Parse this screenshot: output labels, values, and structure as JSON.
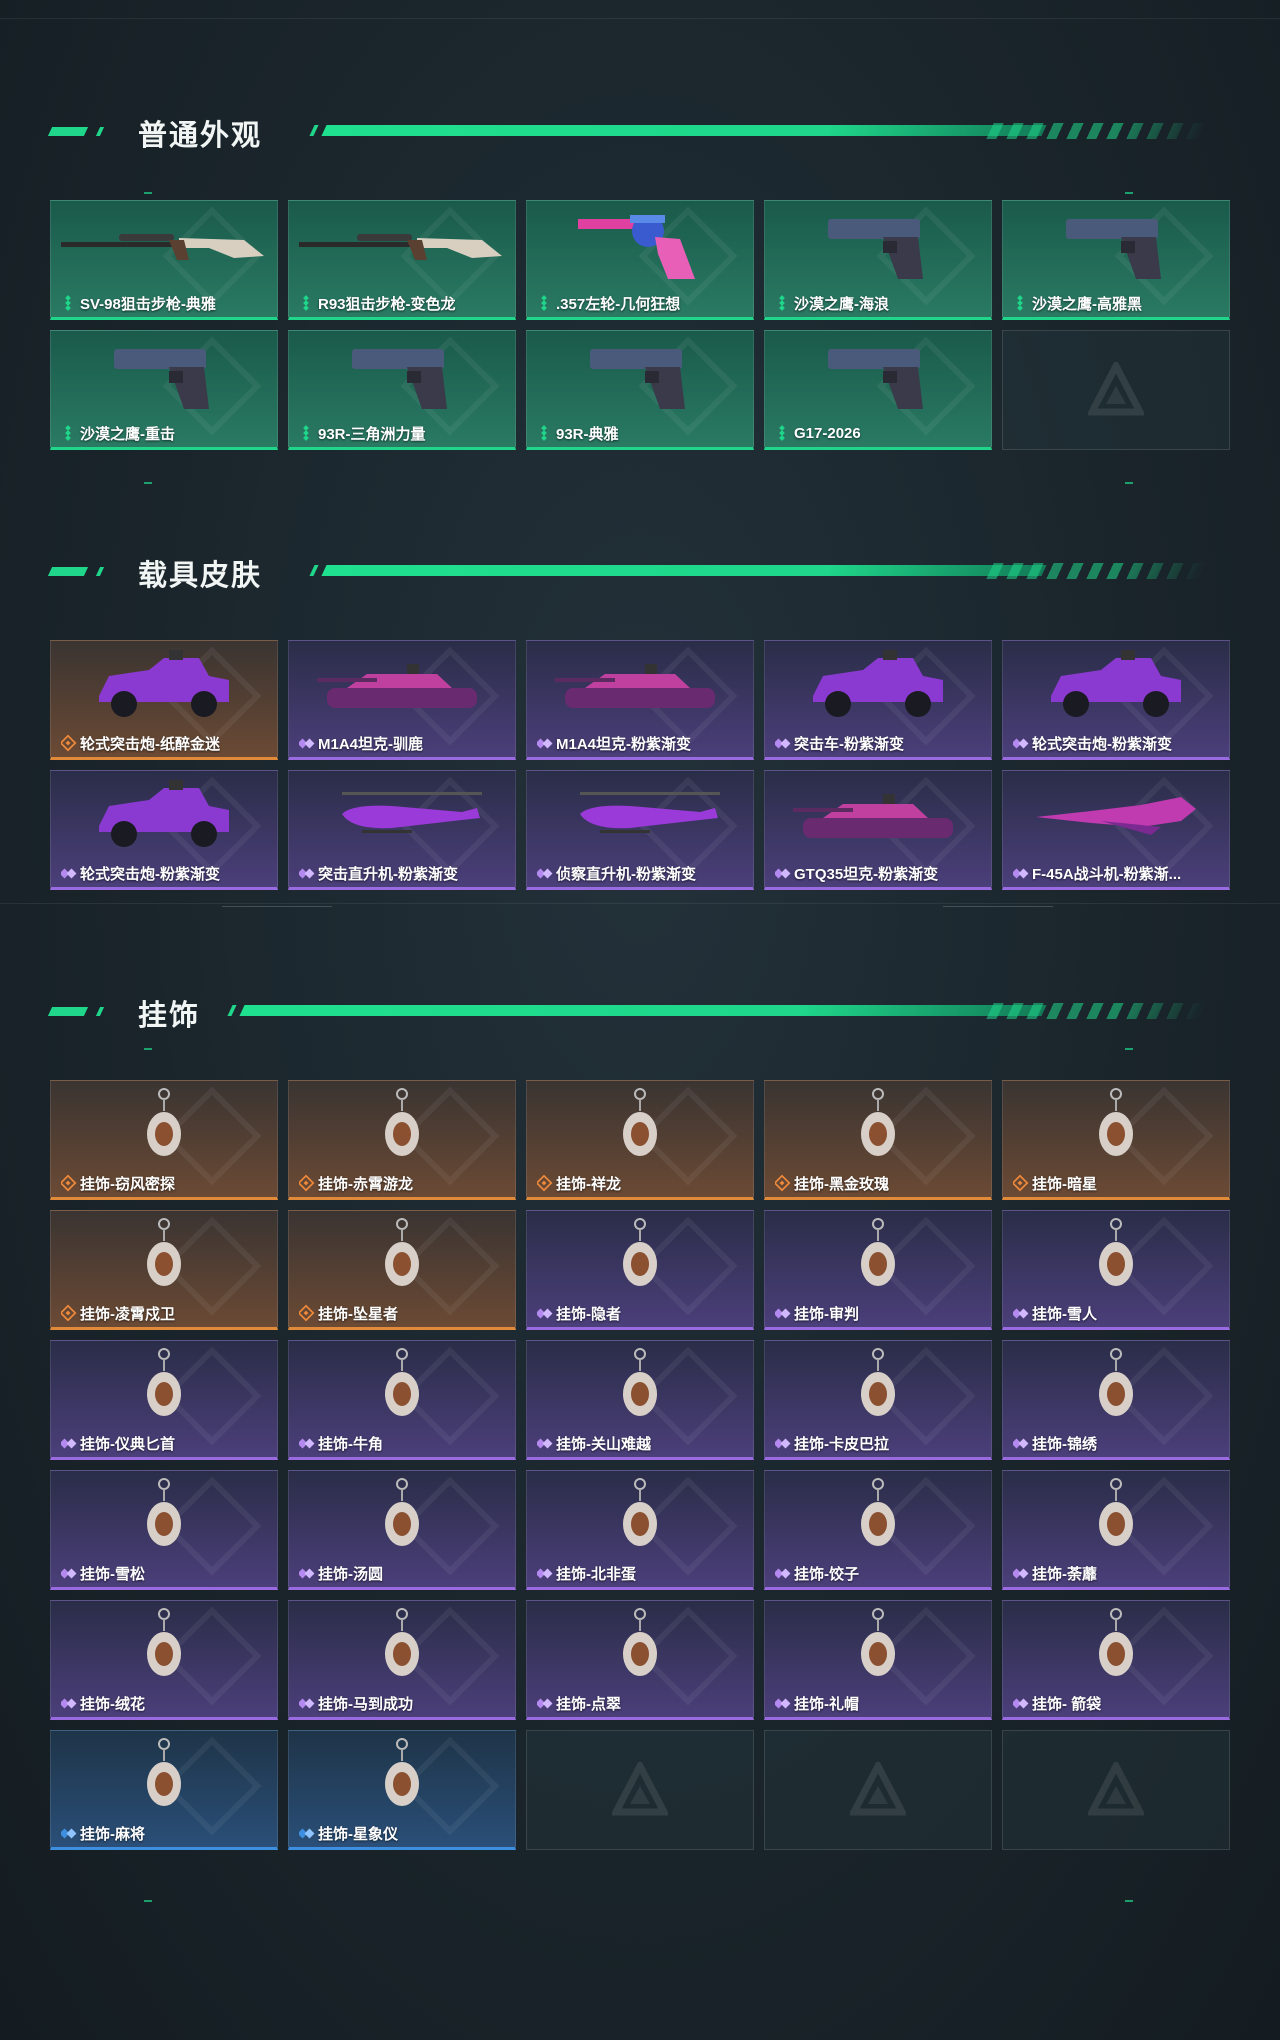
{
  "colors": {
    "accent": "#1fd68a",
    "rarity_green": "#1fd68a",
    "rarity_orange": "#e08a3a",
    "rarity_purple": "#9a6ae0",
    "rarity_blue": "#3f8fe0"
  },
  "sections": [
    {
      "title": "普通外观",
      "items": [
        {
          "label": "SV-98狙击步枪-典雅",
          "rarity": "green",
          "icon": "sniper-rifle-icon"
        },
        {
          "label": "R93狙击步枪-变色龙",
          "rarity": "green",
          "icon": "sniper-rifle-icon"
        },
        {
          "label": ".357左轮-几何狂想",
          "rarity": "green",
          "icon": "revolver-icon"
        },
        {
          "label": "沙漠之鹰-海浪",
          "rarity": "green",
          "icon": "pistol-icon"
        },
        {
          "label": "沙漠之鹰-高雅黑",
          "rarity": "green",
          "icon": "pistol-icon"
        },
        {
          "label": "沙漠之鹰-重击",
          "rarity": "green",
          "icon": "pistol-icon"
        },
        {
          "label": "93R-三角洲力量",
          "rarity": "green",
          "icon": "pistol-icon"
        },
        {
          "label": "93R-典雅",
          "rarity": "green",
          "icon": "pistol-icon"
        },
        {
          "label": "G17-2026",
          "rarity": "green",
          "icon": "pistol-icon"
        },
        {
          "label": "",
          "rarity": "empty",
          "icon": "brand-logo-icon"
        }
      ]
    },
    {
      "title": "载具皮肤",
      "items": [
        {
          "label": "轮式突击炮-纸醉金迷",
          "rarity": "orange",
          "icon": "armored-car-icon"
        },
        {
          "label": "M1A4坦克-驯鹿",
          "rarity": "purple",
          "icon": "tank-icon"
        },
        {
          "label": "M1A4坦克-粉紫渐变",
          "rarity": "purple",
          "icon": "tank-icon"
        },
        {
          "label": "突击车-粉紫渐变",
          "rarity": "purple",
          "icon": "armored-car-icon"
        },
        {
          "label": "轮式突击炮-粉紫渐变",
          "rarity": "purple",
          "icon": "armored-car-icon"
        },
        {
          "label": "轮式突击炮-粉紫渐变",
          "rarity": "purple",
          "icon": "armored-car-icon"
        },
        {
          "label": "突击直升机-粉紫渐变",
          "rarity": "purple",
          "icon": "helicopter-icon"
        },
        {
          "label": "侦察直升机-粉紫渐变",
          "rarity": "purple",
          "icon": "helicopter-icon"
        },
        {
          "label": "GTQ35坦克-粉紫渐变",
          "rarity": "purple",
          "icon": "tank-icon"
        },
        {
          "label": "F-45A战斗机-粉紫渐...",
          "rarity": "purple",
          "icon": "fighter-jet-icon"
        }
      ]
    },
    {
      "title": "挂饰",
      "items": [
        {
          "label": "挂饰-窃风密探",
          "rarity": "orange",
          "icon": "charm-icon"
        },
        {
          "label": "挂饰-赤霄游龙",
          "rarity": "orange",
          "icon": "charm-icon"
        },
        {
          "label": "挂饰-祥龙",
          "rarity": "orange",
          "icon": "charm-icon"
        },
        {
          "label": "挂饰-黑金玫瑰",
          "rarity": "orange",
          "icon": "charm-icon"
        },
        {
          "label": "挂饰-暗星",
          "rarity": "orange",
          "icon": "charm-icon"
        },
        {
          "label": "挂饰-凌霄戍卫",
          "rarity": "orange",
          "icon": "charm-icon"
        },
        {
          "label": "挂饰-坠星者",
          "rarity": "orange",
          "icon": "charm-icon"
        },
        {
          "label": "挂饰-隐者",
          "rarity": "purple",
          "icon": "charm-icon"
        },
        {
          "label": "挂饰-审判",
          "rarity": "purple",
          "icon": "charm-icon"
        },
        {
          "label": "挂饰-雪人",
          "rarity": "purple",
          "icon": "charm-icon"
        },
        {
          "label": "挂饰-仪典匕首",
          "rarity": "purple",
          "icon": "charm-icon"
        },
        {
          "label": "挂饰-牛角",
          "rarity": "purple",
          "icon": "charm-icon"
        },
        {
          "label": "挂饰-关山难越",
          "rarity": "purple",
          "icon": "charm-icon"
        },
        {
          "label": "挂饰-卡皮巴拉",
          "rarity": "purple",
          "icon": "charm-icon"
        },
        {
          "label": "挂饰-锦绣",
          "rarity": "purple",
          "icon": "charm-icon"
        },
        {
          "label": "挂饰-雪松",
          "rarity": "purple",
          "icon": "charm-icon"
        },
        {
          "label": "挂饰-汤圆",
          "rarity": "purple",
          "icon": "charm-icon"
        },
        {
          "label": "挂饰-北非蛋",
          "rarity": "purple",
          "icon": "charm-icon"
        },
        {
          "label": "挂饰-饺子",
          "rarity": "purple",
          "icon": "charm-icon"
        },
        {
          "label": "挂饰-荼蘼",
          "rarity": "purple",
          "icon": "charm-icon"
        },
        {
          "label": "挂饰-绒花",
          "rarity": "purple",
          "icon": "charm-icon"
        },
        {
          "label": "挂饰-马到成功",
          "rarity": "purple",
          "icon": "charm-icon"
        },
        {
          "label": "挂饰-点翠",
          "rarity": "purple",
          "icon": "charm-icon"
        },
        {
          "label": "挂饰-礼帽",
          "rarity": "purple",
          "icon": "charm-icon"
        },
        {
          "label": "挂饰- 箭袋",
          "rarity": "purple",
          "icon": "charm-icon"
        },
        {
          "label": "挂饰-麻将",
          "rarity": "blue",
          "icon": "charm-icon"
        },
        {
          "label": "挂饰-星象仪",
          "rarity": "blue",
          "icon": "charm-icon"
        },
        {
          "label": "",
          "rarity": "empty",
          "icon": "brand-logo-icon"
        },
        {
          "label": "",
          "rarity": "empty",
          "icon": "brand-logo-icon"
        },
        {
          "label": "",
          "rarity": "empty",
          "icon": "brand-logo-icon"
        }
      ]
    }
  ]
}
